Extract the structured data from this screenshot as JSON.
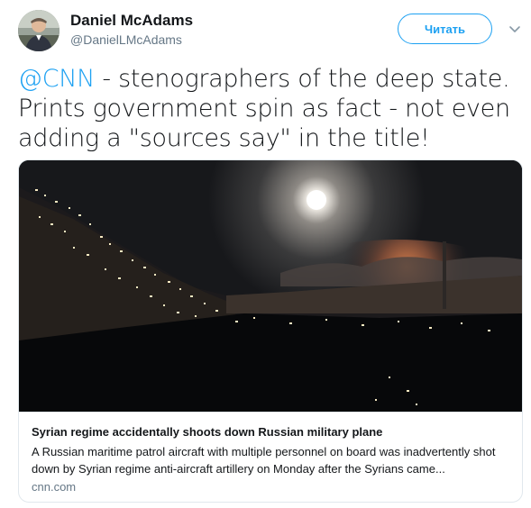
{
  "author": {
    "name": "Daniel McAdams",
    "handle": "@DanielLMcAdams",
    "avatar_icon": "user-avatar"
  },
  "follow_button": {
    "label": "Читать"
  },
  "menu": {
    "icon": "chevron-down-icon"
  },
  "tweet": {
    "mention": "@CNN",
    "text": " - stenographers of the deep state. Prints government spin as fact - not even adding a \"sources say\" in the title!"
  },
  "card": {
    "image_alt": "night-sky-explosion-photo",
    "title": "Syrian regime accidentally shoots down Russian military plane",
    "description": "A Russian maritime patrol aircraft with multiple personnel on board was inadvertently shot down by Syrian regime anti-aircraft artillery on Monday after the Syrians came...",
    "domain": "cnn.com"
  },
  "colors": {
    "accent": "#1da1f2",
    "text": "#14171a",
    "secondary": "#657786",
    "border": "#e1e8ed"
  }
}
